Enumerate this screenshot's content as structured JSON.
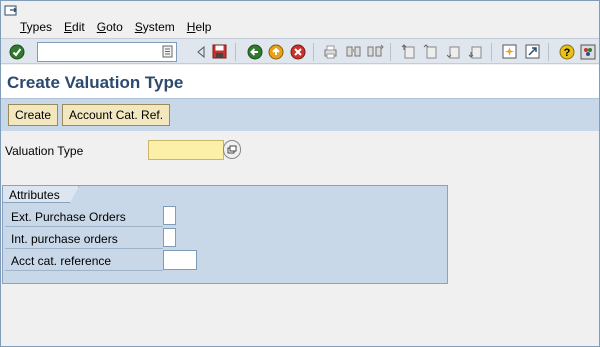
{
  "menu": {
    "items": [
      "Types",
      "Edit",
      "Goto",
      "System",
      "Help"
    ]
  },
  "toolbar": {
    "command_field_value": "",
    "icons": [
      "enter-icon",
      "command-dropdown-icon",
      "back-nav-icon",
      "save-icon",
      "back-icon",
      "exit-icon",
      "cancel-icon",
      "print-icon",
      "find-icon",
      "find-next-icon",
      "first-page-icon",
      "previous-page-icon",
      "next-page-icon",
      "last-page-icon",
      "create-session-icon",
      "shortcut-icon",
      "help-icon",
      "customize-layout-icon"
    ]
  },
  "title": "Create Valuation Type",
  "app_toolbar": {
    "create_label": "Create",
    "account_cat_ref_label": "Account Cat. Ref."
  },
  "form": {
    "valuation_type_label": "Valuation Type",
    "valuation_type_value": ""
  },
  "attributes": {
    "title": "Attributes",
    "ext_purchase_orders_label": "Ext. Purchase Orders",
    "int_purchase_orders_label": "Int. purchase orders",
    "acct_cat_reference_label": "Acct cat. reference",
    "acct_cat_reference_value": ""
  },
  "colors": {
    "title_text": "#2c4a6e",
    "app_toolbar_bg": "#c9d8e8",
    "required_field_bg": "#fcf0a8",
    "button_bg": "#f3e7c0"
  }
}
